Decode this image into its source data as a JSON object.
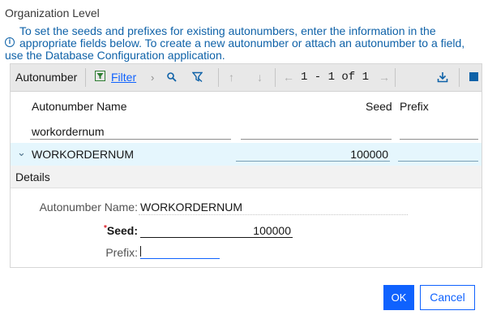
{
  "dialog": {
    "title": "Organization Level",
    "info_line1": "To set the seeds and prefixes for existing autonumbers, enter the information in the",
    "info_line2": "appropriate fields below. To create a new autonumber or attach an autonumber to a field,",
    "info_line3": "use the Database Configuration application.",
    "info_icon": "info-icon"
  },
  "table": {
    "title": "Autonumber",
    "filter_label": "Filter",
    "pager": "1 - 1 of 1",
    "columns": {
      "name": "Autonumber Name",
      "seed": "Seed",
      "prefix": "Prefix"
    },
    "filter_values": {
      "name": "workordernum",
      "seed": "",
      "prefix": ""
    },
    "rows": [
      {
        "name": "WORKORDERNUM",
        "seed": "100000",
        "prefix": ""
      }
    ]
  },
  "details": {
    "header": "Details",
    "name_label": "Autonumber Name:",
    "name_value": "WORKORDERNUM",
    "required_mark": "*",
    "seed_label": "Seed:",
    "seed_value": "100000",
    "prefix_label": "Prefix:",
    "prefix_value": ""
  },
  "buttons": {
    "ok": "OK",
    "cancel": "Cancel"
  },
  "colors": {
    "accent": "#0f62fe",
    "info_text": "#0f62a8",
    "selected_row": "#e5f6fd",
    "toolbar_bg": "#e8e8e8"
  }
}
